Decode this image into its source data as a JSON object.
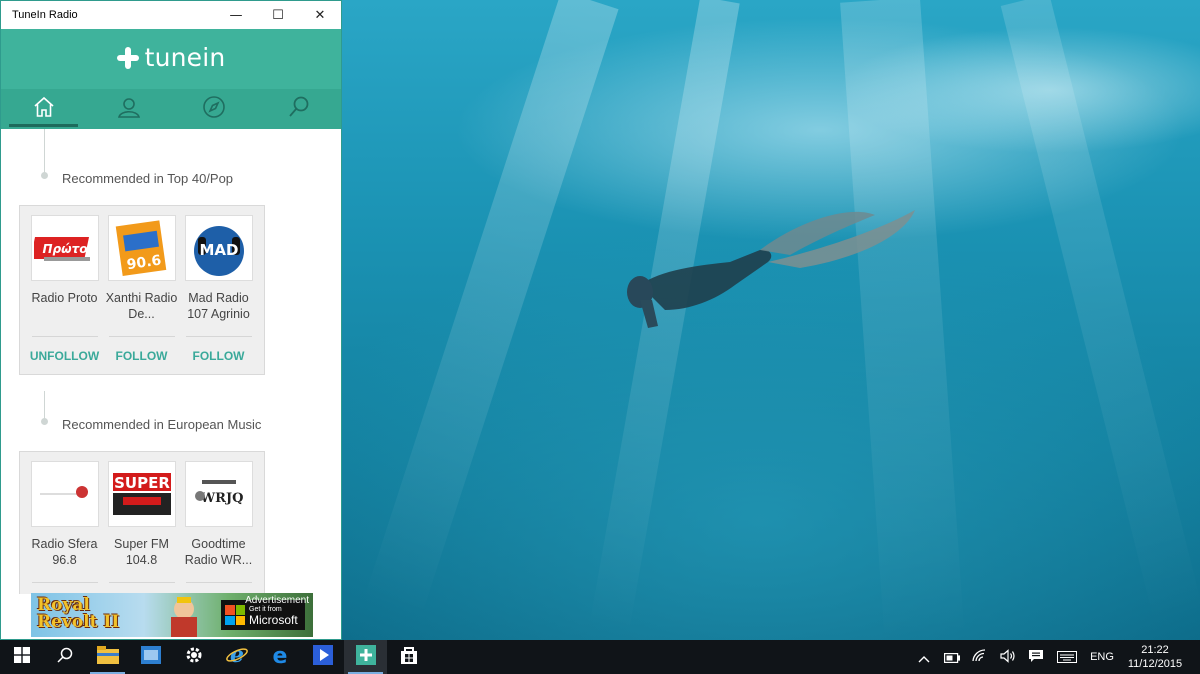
{
  "window": {
    "title": "TuneIn Radio",
    "minimize_glyph": "—",
    "maximize_glyph": "☐",
    "close_glyph": "✕"
  },
  "brand": {
    "logo_text": "tunein",
    "accent": "#3fb39c",
    "nav_bg": "#36a891",
    "follow_color": "#3aa99a"
  },
  "nav": {
    "tabs": [
      {
        "name": "home-icon",
        "active": true
      },
      {
        "name": "profile-icon",
        "active": false
      },
      {
        "name": "compass-icon",
        "active": false
      },
      {
        "name": "search-icon",
        "active": false
      }
    ]
  },
  "sections": [
    {
      "label": "Recommended in Top 40/Pop",
      "stations": [
        {
          "name": "Radio Proto",
          "action": "UNFOLLOW",
          "logo_text": "Πρώτο"
        },
        {
          "name": "Xanthi Radio De...",
          "action": "FOLLOW",
          "logo_text": "90.6"
        },
        {
          "name": "Mad Radio 107 Agrinio",
          "action": "FOLLOW",
          "logo_text": "MAD"
        }
      ]
    },
    {
      "label": "Recommended in European Music",
      "stations": [
        {
          "name": "Radio Sfera 96.8",
          "action": "",
          "logo_text": ""
        },
        {
          "name": "Super FM 104.8",
          "action": "",
          "logo_text": "SUPER"
        },
        {
          "name": "Goodtime Radio WR...",
          "action": "",
          "logo_text": "WRJQ"
        }
      ]
    }
  ],
  "ad": {
    "game_line1": "Royal",
    "game_line2": "Revolt II",
    "label": "Advertisement",
    "badge_small": "Get it from",
    "badge_big": "Microsoft"
  },
  "taskbar": {
    "lang": "ENG",
    "time": "21:22",
    "date": "11/12/2015"
  }
}
